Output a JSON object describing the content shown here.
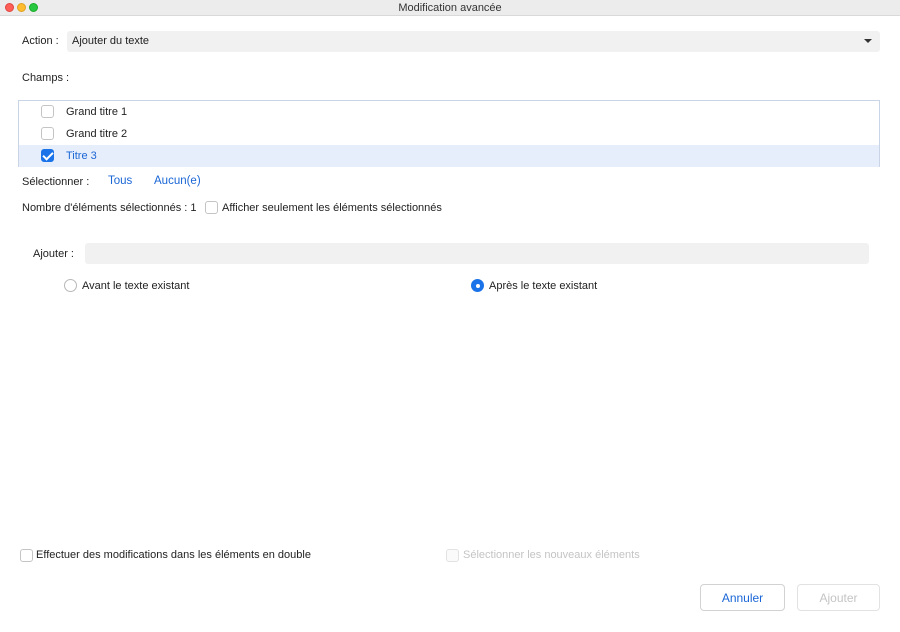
{
  "window": {
    "title": "Modification avancée"
  },
  "action": {
    "label": "Action :",
    "value": "Ajouter du texte"
  },
  "fields": {
    "label": "Champs :",
    "items": [
      {
        "label": "Grand titre 1",
        "checked": false
      },
      {
        "label": "Grand titre 2",
        "checked": false
      },
      {
        "label": "Titre 3",
        "checked": true
      }
    ]
  },
  "select": {
    "label": "Sélectionner :",
    "all": "Tous",
    "none": "Aucun(e)"
  },
  "count": {
    "label": "Nombre d'éléments sélectionnés : 1",
    "show_only_label": "Afficher seulement les éléments sélectionnés"
  },
  "add": {
    "label": "Ajouter :",
    "value": "",
    "before_label": "Avant le texte existant",
    "after_label": "Après le texte existant",
    "selected": "after"
  },
  "footer": {
    "duplicates_label": "Effectuer des modifications dans les éléments en double",
    "select_new_label": "Sélectionner les nouveaux éléments",
    "cancel_label": "Annuler",
    "submit_label": "Ajouter"
  },
  "colors": {
    "accent": "#1a73e8",
    "link": "#1a66d6",
    "selected_row": "#e6eefb",
    "disabled": "#c4c4c4"
  }
}
